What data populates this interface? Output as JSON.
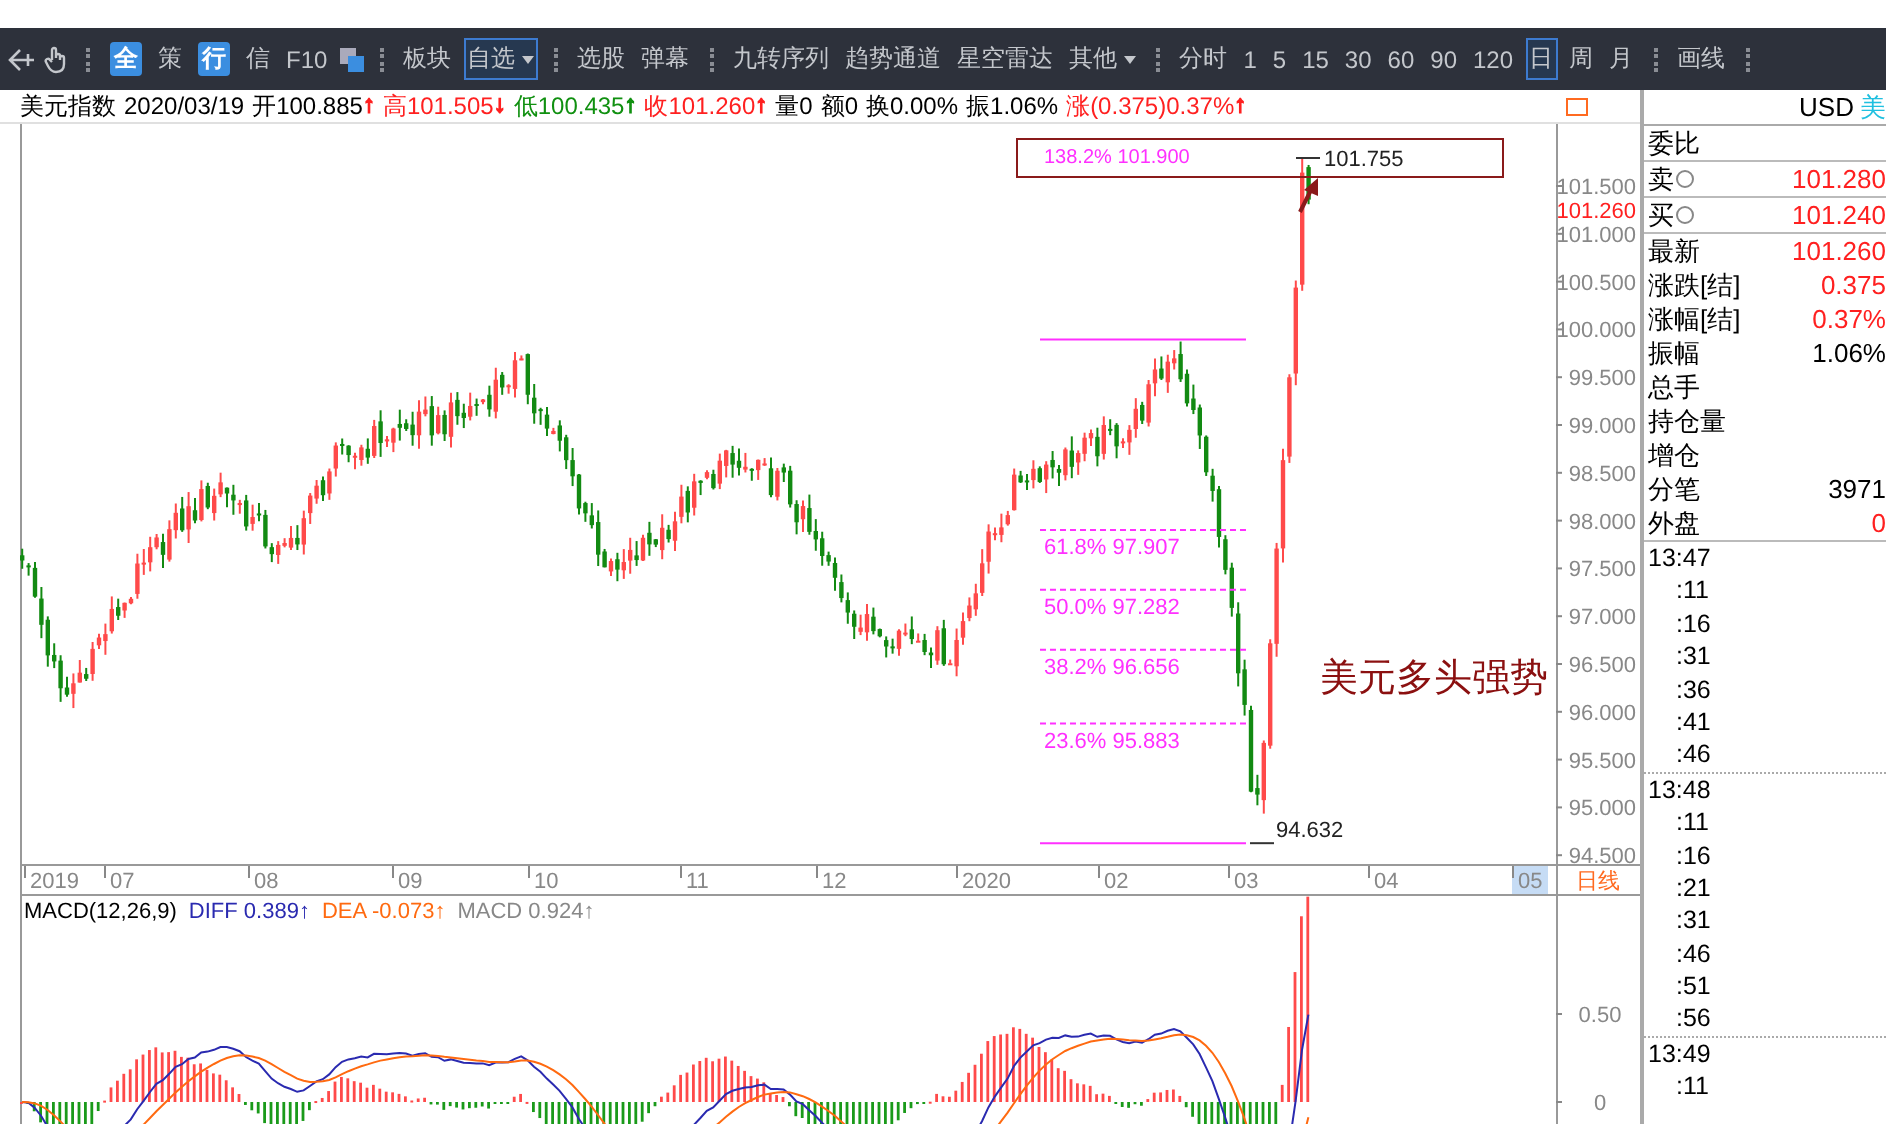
{
  "toolbar": {
    "groups": [
      [
        {
          "label": "全",
          "kind": "badge",
          "selected": false
        },
        {
          "label": "策",
          "kind": "text",
          "selected": false
        },
        {
          "label": "行",
          "kind": "badge",
          "selected": false
        },
        {
          "label": "信",
          "kind": "text",
          "selected": false
        },
        {
          "label": "F10",
          "kind": "text",
          "selected": false
        }
      ],
      [
        {
          "label": "板块",
          "kind": "text",
          "selected": false
        },
        {
          "label": "自选",
          "kind": "dropdown",
          "selected": true
        }
      ],
      [
        {
          "label": "选股",
          "kind": "text",
          "selected": false
        },
        {
          "label": "弹幕",
          "kind": "text",
          "selected": false
        }
      ],
      [
        {
          "label": "九转序列",
          "kind": "text",
          "selected": false
        },
        {
          "label": "趋势通道",
          "kind": "text",
          "selected": false
        },
        {
          "label": "星空雷达",
          "kind": "text",
          "selected": false
        },
        {
          "label": "其他",
          "kind": "dropdown",
          "selected": false
        }
      ],
      [
        {
          "label": "分时",
          "kind": "text",
          "selected": false
        },
        {
          "label": "1",
          "kind": "text",
          "selected": false
        },
        {
          "label": "5",
          "kind": "text",
          "selected": false
        },
        {
          "label": "15",
          "kind": "text",
          "selected": false
        },
        {
          "label": "30",
          "kind": "text",
          "selected": false
        },
        {
          "label": "60",
          "kind": "text",
          "selected": false
        },
        {
          "label": "90",
          "kind": "text",
          "selected": false
        },
        {
          "label": "120",
          "kind": "text",
          "selected": false
        },
        {
          "label": "日",
          "kind": "text",
          "selected": true
        },
        {
          "label": "周",
          "kind": "text",
          "selected": false
        },
        {
          "label": "月",
          "kind": "text",
          "selected": false
        }
      ],
      [
        {
          "label": "画线",
          "kind": "text",
          "selected": false
        }
      ]
    ]
  },
  "quote_line": {
    "symbol": "美元指数",
    "date": "2020/03/19",
    "fields": [
      {
        "text": "开100.885",
        "color": "#000000",
        "arrow": {
          "symbol": "↑",
          "color": "#ff2020"
        }
      },
      {
        "text": "高101.505",
        "color": "#ff2020",
        "arrow": {
          "symbol": "↓",
          "color": "#ff2020"
        }
      },
      {
        "text": "低100.435",
        "color": "#109010",
        "arrow": {
          "symbol": "↑",
          "color": "#109010"
        }
      },
      {
        "text": "收101.260",
        "color": "#ff2020",
        "arrow": {
          "symbol": "↑",
          "color": "#ff2020"
        }
      },
      {
        "text": "量0",
        "color": "#000000"
      },
      {
        "text": "额0",
        "color": "#000000"
      },
      {
        "text": "换0.00%",
        "color": "#000000"
      },
      {
        "text": "振1.06%",
        "color": "#000000"
      },
      {
        "text": "涨(0.375)0.37%",
        "color": "#ff2020",
        "arrow": {
          "symbol": "↑",
          "color": "#ff2020"
        }
      }
    ]
  },
  "chart": {
    "y_ticks": [
      "101.500",
      "101.000",
      "100.500",
      "100.000",
      "99.500",
      "99.000",
      "98.500",
      "98.000",
      "97.500",
      "97.000",
      "96.500",
      "96.000",
      "95.500",
      "95.000",
      "94.500"
    ],
    "last_price": "101.260",
    "fib_levels": [
      {
        "label": "138.2% 101.900",
        "kind": "boxed"
      },
      {
        "label": "61.8% 97.907",
        "kind": "dashed"
      },
      {
        "label": "50.0% 97.282",
        "kind": "dashed"
      },
      {
        "label": "38.2% 96.656",
        "kind": "dashed"
      },
      {
        "label": "23.6% 95.883",
        "kind": "dashed"
      }
    ],
    "high_mark": "101.755",
    "low_mark": "94.632",
    "annotation": "美元多头强势",
    "x_labels": [
      {
        "label": "2019",
        "highlighted": false
      },
      {
        "label": "07",
        "highlighted": false
      },
      {
        "label": "08",
        "highlighted": false
      },
      {
        "label": "09",
        "highlighted": false
      },
      {
        "label": "10",
        "highlighted": false
      },
      {
        "label": "11",
        "highlighted": false
      },
      {
        "label": "12",
        "highlighted": false
      },
      {
        "label": "2020",
        "highlighted": false
      },
      {
        "label": "02",
        "highlighted": false
      },
      {
        "label": "03",
        "highlighted": false
      },
      {
        "label": "04",
        "highlighted": false
      },
      {
        "label": "05",
        "highlighted": true
      }
    ],
    "period_label": "日线"
  },
  "macd": {
    "title": "MACD(12,26,9)",
    "lines": [
      {
        "text": "DIFF 0.389↑",
        "color": "#2a2ab0"
      },
      {
        "text": "DEA -0.073↑",
        "color": "#ff6a10"
      },
      {
        "text": "MACD 0.924↑",
        "color": "#888888"
      }
    ],
    "y_ticks": [
      "0.50",
      "0"
    ]
  },
  "quote_panel": {
    "code": "USD",
    "name": "美",
    "groups": [
      [
        {
          "label": "委比",
          "kind": "plain"
        }
      ],
      [
        {
          "label": "卖",
          "kind": "info",
          "value": "101.280",
          "color": "#ff2020"
        }
      ],
      [
        {
          "label": "买",
          "kind": "info",
          "value": "101.240",
          "color": "#ff2020"
        }
      ],
      [
        {
          "label": "最新",
          "kind": "plain",
          "value": "101.260",
          "color": "#ff2020"
        },
        {
          "label": "涨跌[结]",
          "kind": "plain",
          "value": "0.375",
          "color": "#ff2020"
        },
        {
          "label": "涨幅[结]",
          "kind": "plain",
          "value": "0.37%",
          "color": "#ff2020"
        },
        {
          "label": "振幅",
          "kind": "plain",
          "value": "1.06%",
          "color": "#000000"
        },
        {
          "label": "总手",
          "kind": "plain"
        },
        {
          "label": "持仓量",
          "kind": "plain"
        },
        {
          "label": "增仓",
          "kind": "plain"
        },
        {
          "label": "分笔",
          "kind": "plain",
          "value": "3971",
          "color": "#000000"
        },
        {
          "label": "外盘",
          "kind": "plain",
          "value": "0",
          "color": "#ff2020"
        }
      ]
    ],
    "ticks": [
      {
        "label": "13:47",
        "kind": "minute"
      },
      {
        "label": ":11",
        "kind": "second"
      },
      {
        "label": ":16",
        "kind": "second"
      },
      {
        "label": ":31",
        "kind": "second"
      },
      {
        "label": ":36",
        "kind": "second"
      },
      {
        "label": ":41",
        "kind": "second"
      },
      {
        "label": ":46",
        "kind": "second"
      },
      {
        "label": "13:48",
        "kind": "minute"
      },
      {
        "label": ":11",
        "kind": "second"
      },
      {
        "label": ":16",
        "kind": "second"
      },
      {
        "label": ":21",
        "kind": "second"
      },
      {
        "label": ":31",
        "kind": "second"
      },
      {
        "label": ":46",
        "kind": "second"
      },
      {
        "label": ":51",
        "kind": "second"
      },
      {
        "label": ":56",
        "kind": "second"
      },
      {
        "label": "13:49",
        "kind": "minute"
      },
      {
        "label": ":11",
        "kind": "second"
      }
    ]
  }
}
